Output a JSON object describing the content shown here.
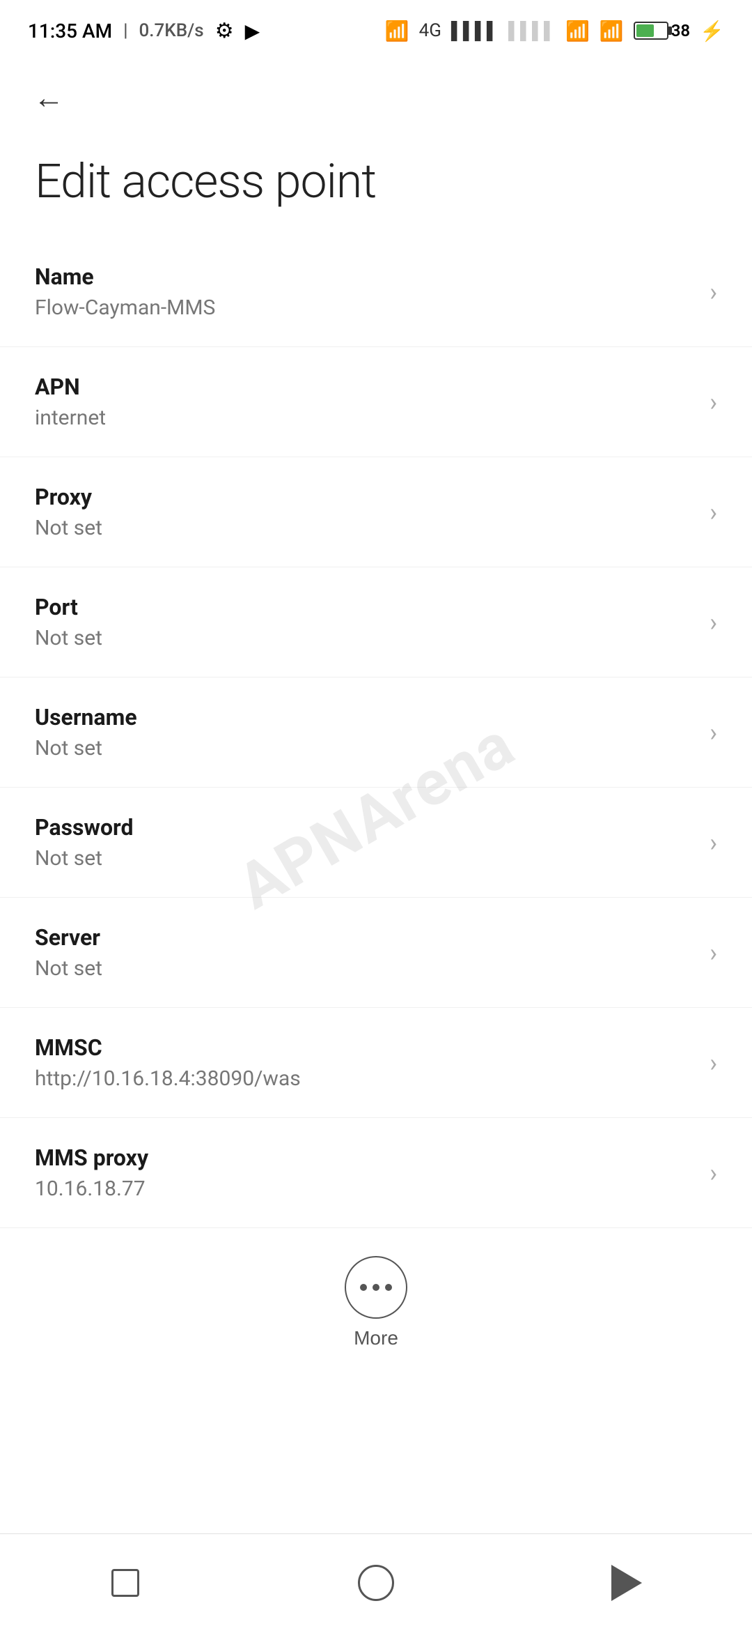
{
  "status_bar": {
    "time": "11:35 AM",
    "network_speed": "0.7KB/s",
    "battery_percent": "38"
  },
  "page": {
    "title": "Edit access point",
    "back_label": "Back"
  },
  "settings": {
    "items": [
      {
        "label": "Name",
        "value": "Flow-Cayman-MMS"
      },
      {
        "label": "APN",
        "value": "internet"
      },
      {
        "label": "Proxy",
        "value": "Not set"
      },
      {
        "label": "Port",
        "value": "Not set"
      },
      {
        "label": "Username",
        "value": "Not set"
      },
      {
        "label": "Password",
        "value": "Not set"
      },
      {
        "label": "Server",
        "value": "Not set"
      },
      {
        "label": "MMSC",
        "value": "http://10.16.18.4:38090/was"
      },
      {
        "label": "MMS proxy",
        "value": "10.16.18.77"
      }
    ]
  },
  "more_button": {
    "label": "More"
  },
  "bottom_nav": {
    "square_label": "Recent apps",
    "circle_label": "Home",
    "triangle_label": "Back"
  },
  "watermark": {
    "text": "APNArena"
  }
}
